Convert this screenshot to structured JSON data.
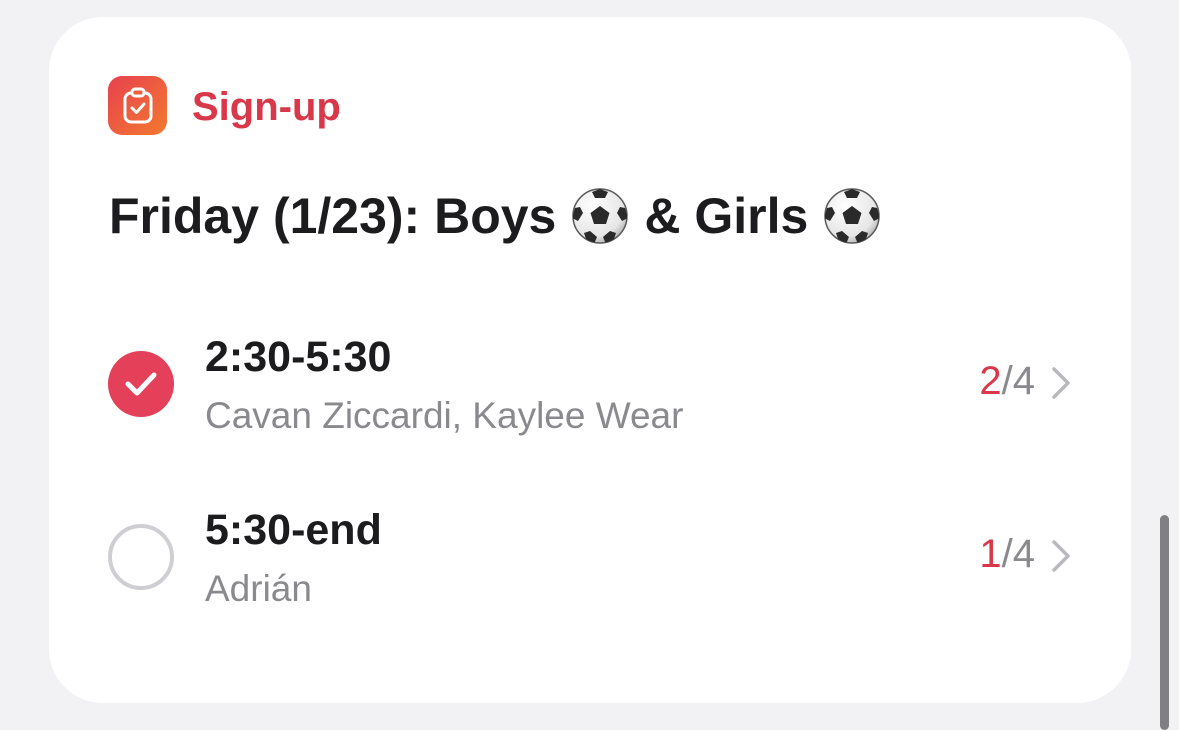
{
  "card": {
    "app_name": "Sign-up",
    "app_icon": "clipboard-check-icon",
    "title_part1": "Friday (1/23): Boys",
    "title_part2": "& Girls",
    "title_emoji": "soccer-ball-icon"
  },
  "slots": [
    {
      "time": "2:30-5:30",
      "names": "Cavan Ziccardi, Kaylee Wear",
      "filled": "2",
      "total": "/4",
      "selected": true
    },
    {
      "time": "5:30-end",
      "names": "Adrián",
      "filled": "1",
      "total": "/4",
      "selected": false
    }
  ],
  "colors": {
    "accent": "#d8384a",
    "check_fill": "#e4405a",
    "secondary_text": "#8a8a8e",
    "background": "#f2f2f4"
  }
}
